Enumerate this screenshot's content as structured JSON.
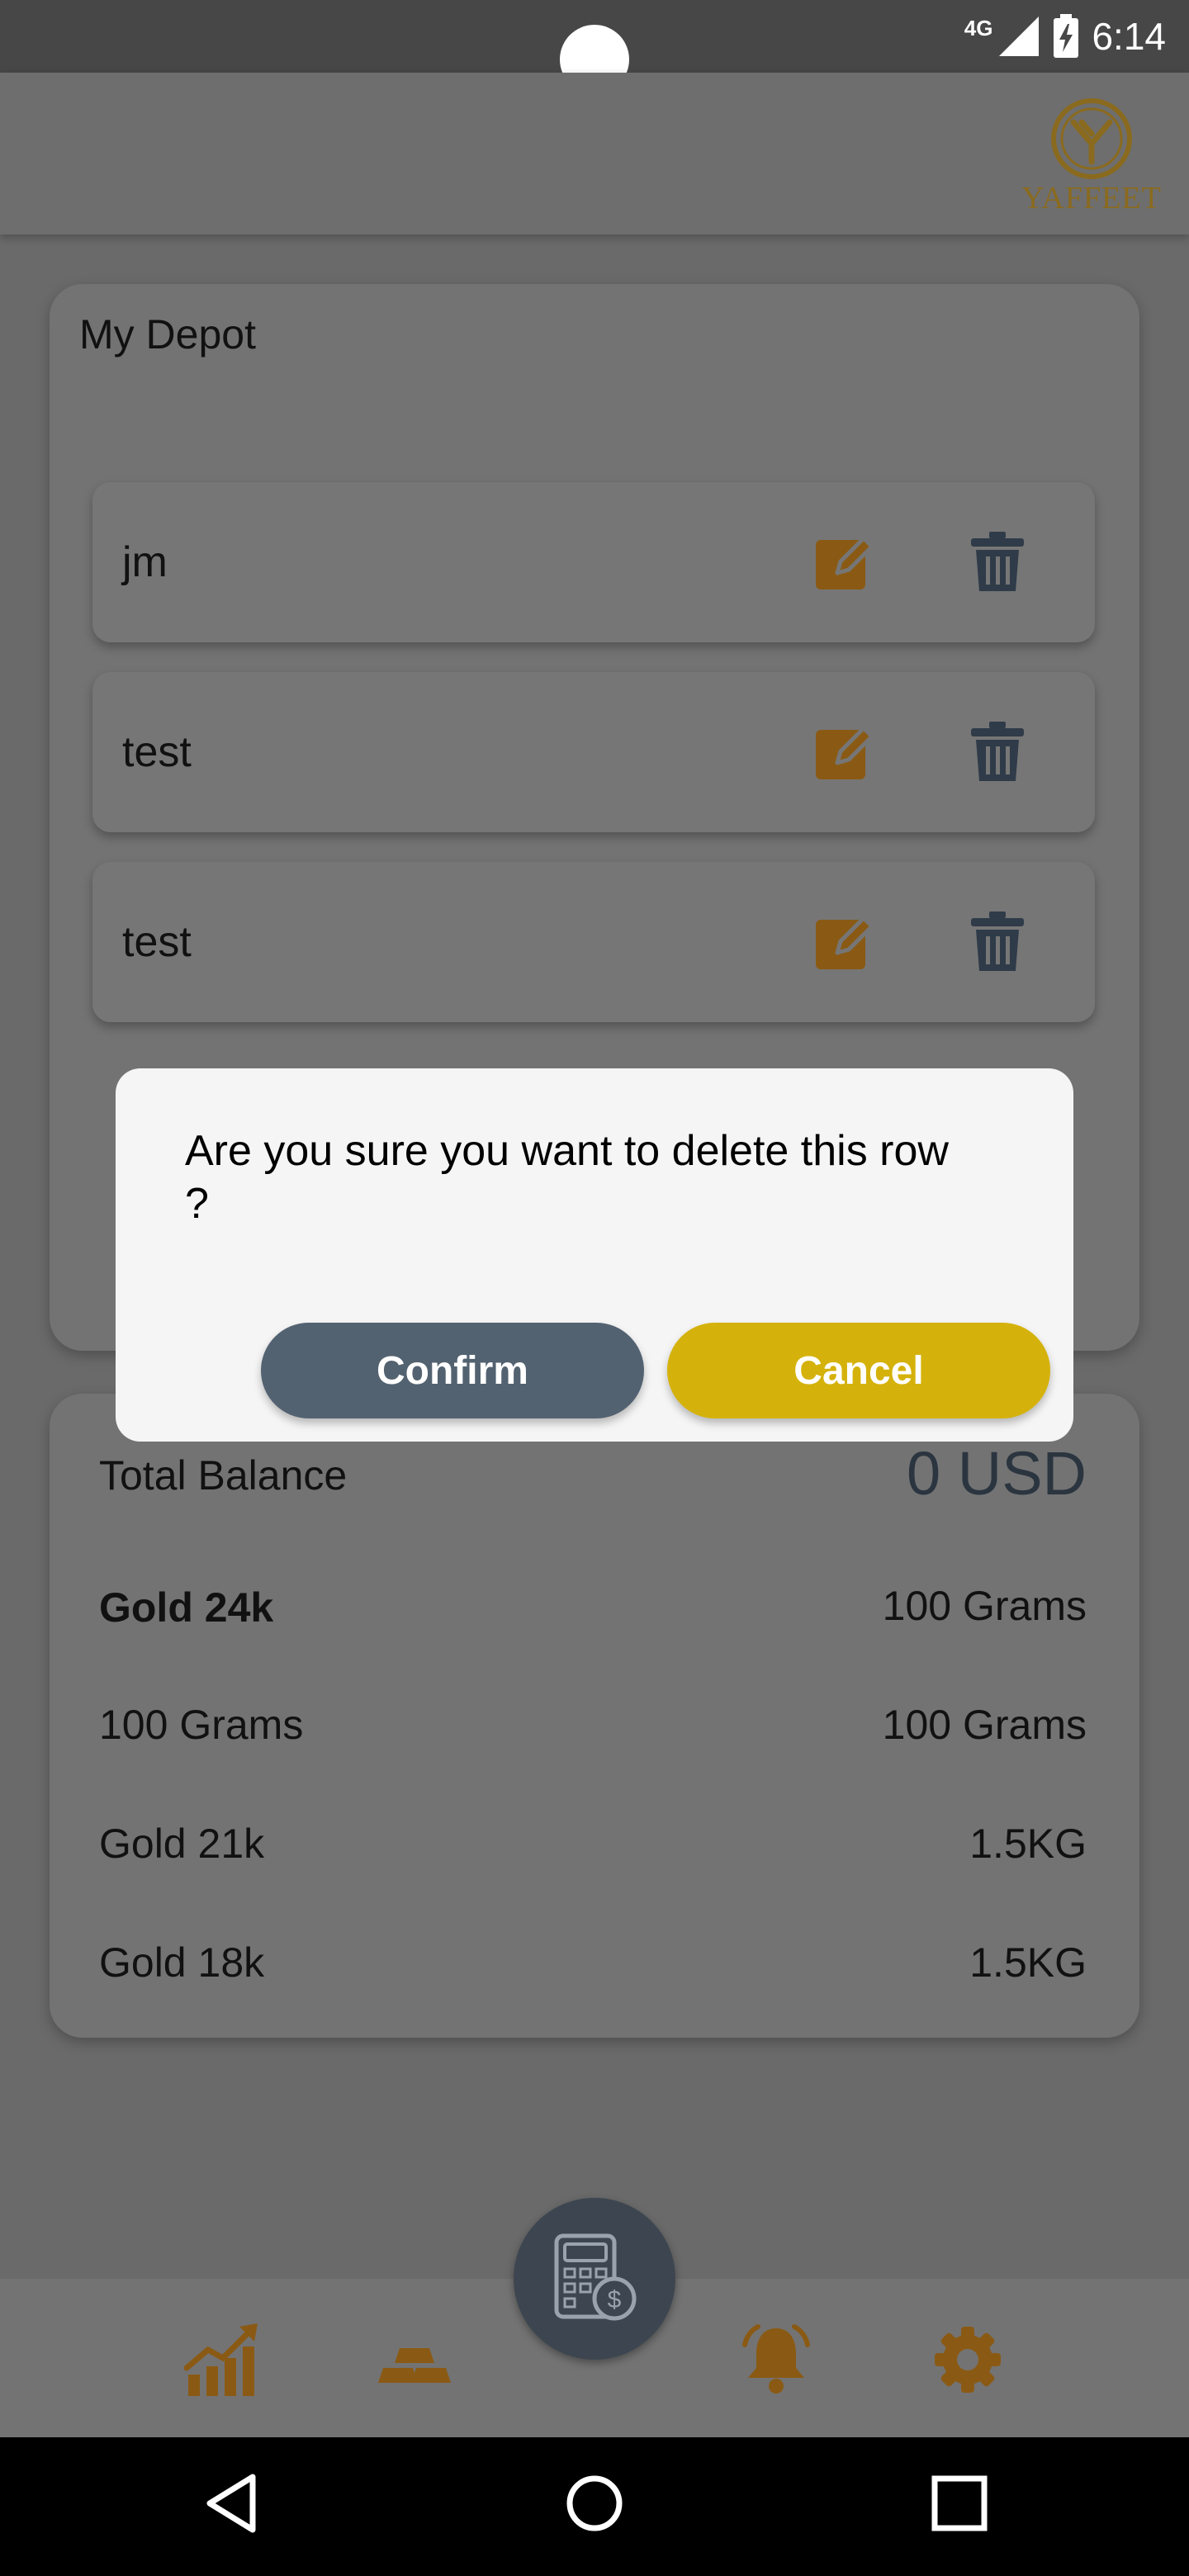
{
  "status_bar": {
    "network": "4G",
    "time": "6:14"
  },
  "header": {
    "logo_text": "YAFFEET"
  },
  "depot": {
    "title": "My Depot",
    "rows": [
      {
        "label": "jm"
      },
      {
        "label": "test"
      },
      {
        "label": "test"
      }
    ]
  },
  "balance": {
    "total_label": "Total Balance",
    "total_value": "0 USD",
    "items": [
      {
        "label": "Gold 24k",
        "value": "100 Grams"
      },
      {
        "label": "100 Grams",
        "value": "100 Grams"
      },
      {
        "label": "Gold 21k",
        "value": "1.5KG"
      },
      {
        "label": "Gold 18k",
        "value": "1.5KG"
      }
    ]
  },
  "dialog": {
    "message": "Are you sure you want to delete this row ?",
    "confirm_label": "Confirm",
    "cancel_label": "Cancel"
  },
  "bottom_nav": {
    "items": [
      "chart-icon",
      "gold-bars-icon",
      "calculator-icon",
      "bell-icon",
      "settings-gear-icon"
    ]
  },
  "colors": {
    "accent_gold": "#d5b20b",
    "edit_icon": "#8a5a14",
    "confirm_button": "#536271",
    "overlay_gray": "#6a6a6a"
  }
}
